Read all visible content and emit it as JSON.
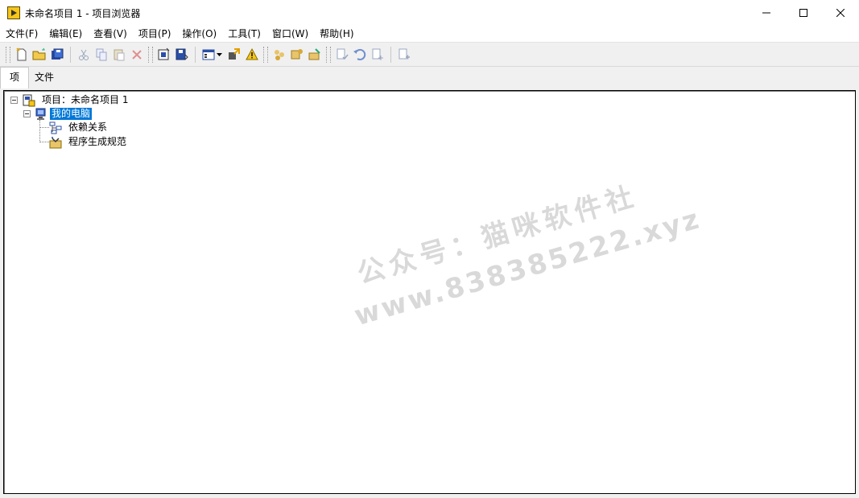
{
  "window": {
    "title": "未命名项目 1 - 项目浏览器",
    "accent_color": "#0078d7",
    "app_icon": "labview-app-icon",
    "controls": [
      "minimize",
      "maximize",
      "close"
    ]
  },
  "menubar": {
    "items": [
      "文件(F)",
      "编辑(E)",
      "查看(V)",
      "项目(P)",
      "操作(O)",
      "工具(T)",
      "窗口(W)",
      "帮助(H)"
    ]
  },
  "toolbar": {
    "icons": [
      "new-icon",
      "open-folder-icon",
      "save-all-icon",
      "cut-icon",
      "copy-icon",
      "paste-icon",
      "delete-icon",
      "project-properties-icon",
      "save-project-icon",
      "view-menu-icon",
      "deploy-icon",
      "warning-icon",
      "build-icon",
      "build-all-icon",
      "clean-icon",
      "source-control-icon",
      "undo-checkout-icon",
      "check-in-icon",
      "add-to-source-icon"
    ]
  },
  "tabs": {
    "items": [
      "项",
      "文件"
    ],
    "active": "项"
  },
  "tree": {
    "root_label": "项目：未命名项目 1",
    "computer_label": "我的电脑",
    "children": [
      "依赖关系",
      "程序生成规范"
    ]
  },
  "watermark": {
    "line1": "公众号：猫咪软件社",
    "line2": "www.838385222.xyz"
  }
}
